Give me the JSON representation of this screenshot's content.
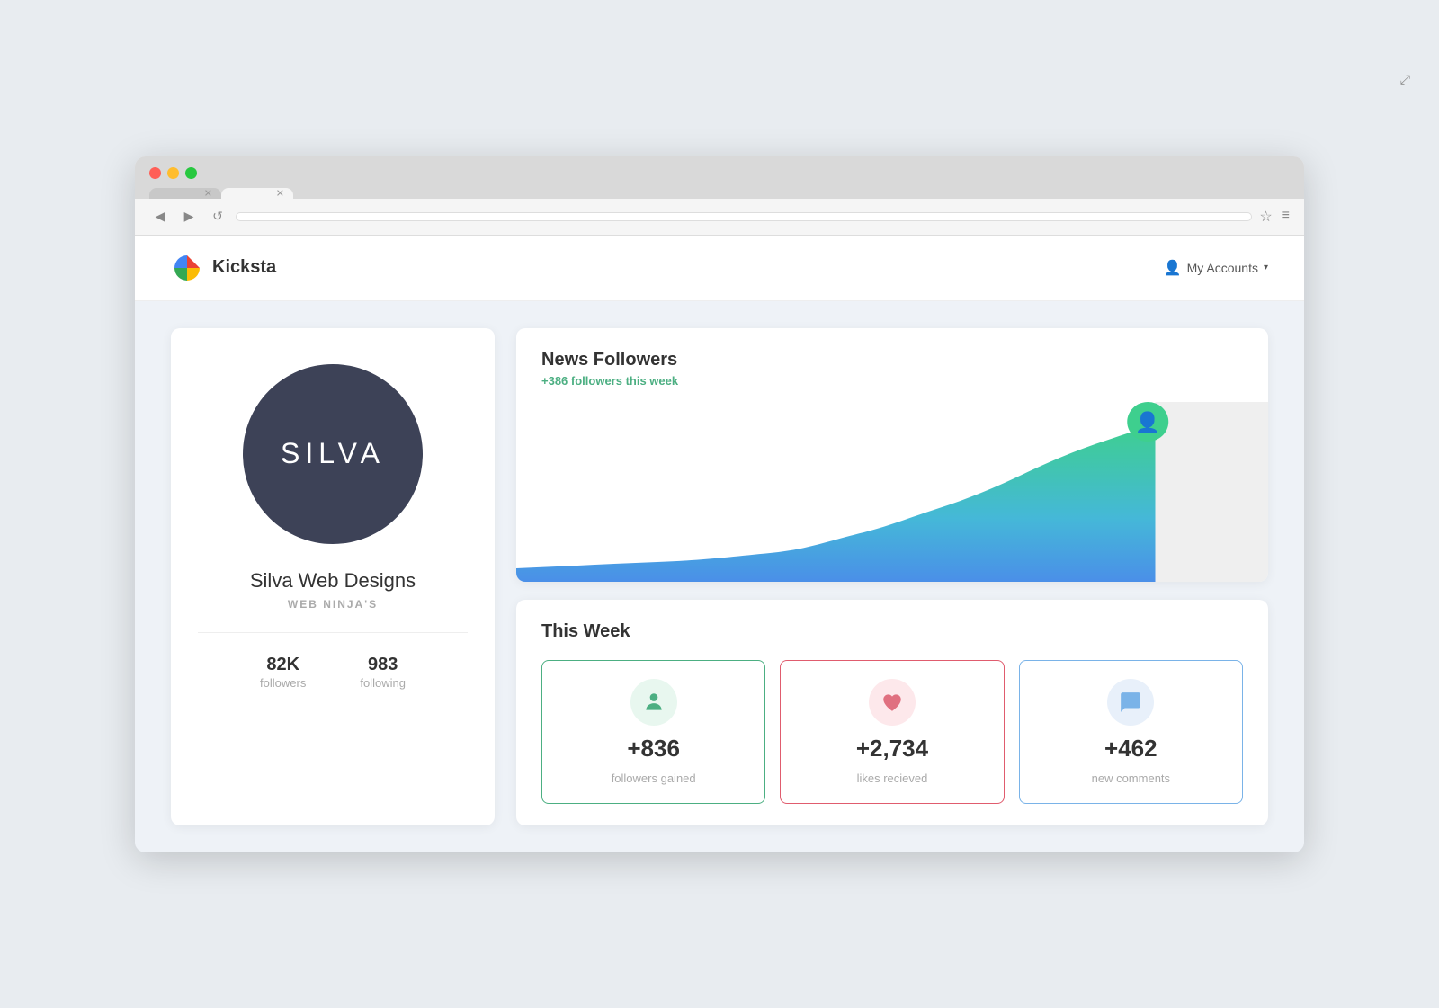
{
  "browser": {
    "tab1_label": "",
    "tab2_label": "",
    "address": "",
    "back_icon": "◀",
    "forward_icon": "▶",
    "refresh_icon": "↺",
    "star_icon": "☆",
    "menu_icon": "≡",
    "expand_icon": "⤢"
  },
  "header": {
    "logo_text": "Kicksta",
    "my_accounts_label": "My Accounts",
    "my_accounts_icon": "👤",
    "chevron": "▾"
  },
  "profile": {
    "avatar_text": "SILVA",
    "name": "Silva Web Designs",
    "subtitle": "WEB NINJA'S",
    "followers_count": "82K",
    "followers_label": "followers",
    "following_count": "983",
    "following_label": "following"
  },
  "chart": {
    "title": "News Followers",
    "subtitle_prefix": "+386",
    "subtitle_suffix": " followers this week"
  },
  "this_week": {
    "title": "This Week",
    "cards": [
      {
        "icon": "👤",
        "icon_type": "person",
        "number": "+836",
        "label": "followers gained",
        "border_color": "green"
      },
      {
        "icon": "♥",
        "icon_type": "heart",
        "number": "+2,734",
        "label": "likes recieved",
        "border_color": "red"
      },
      {
        "icon": "💬",
        "icon_type": "comment",
        "number": "+462",
        "label": "new comments",
        "border_color": "blue"
      }
    ]
  }
}
